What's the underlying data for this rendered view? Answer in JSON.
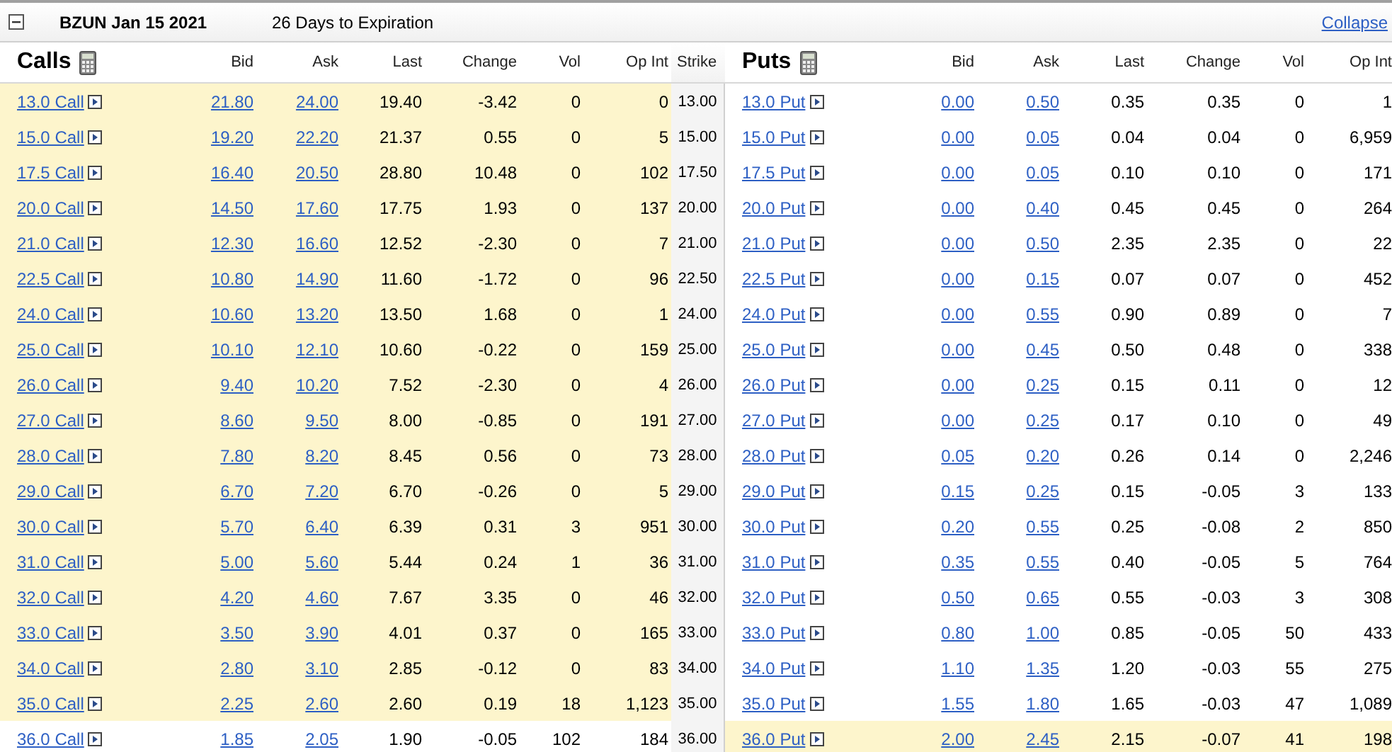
{
  "header": {
    "symbol_date": "BZUN Jan 15 2021",
    "expiration": "26 Days to Expiration",
    "collapse_link": "Collapse",
    "expanded": true
  },
  "columns": {
    "calls_title": "Calls",
    "puts_title": "Puts",
    "calls": [
      "Bid",
      "Ask",
      "Last",
      "Change",
      "Vol",
      "Op Int"
    ],
    "strike": "Strike",
    "puts": [
      "Bid",
      "Ask",
      "Last",
      "Change",
      "Vol",
      "Op Int"
    ]
  },
  "rows": [
    {
      "strike": "13.00",
      "call": {
        "contract": "13.0 Call",
        "bid": "21.80",
        "ask": "24.00",
        "last": "19.40",
        "change": "-3.42",
        "vol": "0",
        "op_int": "0",
        "in_the_money": true
      },
      "put": {
        "contract": "13.0 Put",
        "bid": "0.00",
        "ask": "0.50",
        "last": "0.35",
        "change": "0.35",
        "vol": "0",
        "op_int": "1",
        "in_the_money": false
      }
    },
    {
      "strike": "15.00",
      "call": {
        "contract": "15.0 Call",
        "bid": "19.20",
        "ask": "22.20",
        "last": "21.37",
        "change": "0.55",
        "vol": "0",
        "op_int": "5",
        "in_the_money": true
      },
      "put": {
        "contract": "15.0 Put",
        "bid": "0.00",
        "ask": "0.05",
        "last": "0.04",
        "change": "0.04",
        "vol": "0",
        "op_int": "6,959",
        "in_the_money": false
      }
    },
    {
      "strike": "17.50",
      "call": {
        "contract": "17.5 Call",
        "bid": "16.40",
        "ask": "20.50",
        "last": "28.80",
        "change": "10.48",
        "vol": "0",
        "op_int": "102",
        "in_the_money": true
      },
      "put": {
        "contract": "17.5 Put",
        "bid": "0.00",
        "ask": "0.05",
        "last": "0.10",
        "change": "0.10",
        "vol": "0",
        "op_int": "171",
        "in_the_money": false
      }
    },
    {
      "strike": "20.00",
      "call": {
        "contract": "20.0 Call",
        "bid": "14.50",
        "ask": "17.60",
        "last": "17.75",
        "change": "1.93",
        "vol": "0",
        "op_int": "137",
        "in_the_money": true
      },
      "put": {
        "contract": "20.0 Put",
        "bid": "0.00",
        "ask": "0.40",
        "last": "0.45",
        "change": "0.45",
        "vol": "0",
        "op_int": "264",
        "in_the_money": false
      }
    },
    {
      "strike": "21.00",
      "call": {
        "contract": "21.0 Call",
        "bid": "12.30",
        "ask": "16.60",
        "last": "12.52",
        "change": "-2.30",
        "vol": "0",
        "op_int": "7",
        "in_the_money": true
      },
      "put": {
        "contract": "21.0 Put",
        "bid": "0.00",
        "ask": "0.50",
        "last": "2.35",
        "change": "2.35",
        "vol": "0",
        "op_int": "22",
        "in_the_money": false
      }
    },
    {
      "strike": "22.50",
      "call": {
        "contract": "22.5 Call",
        "bid": "10.80",
        "ask": "14.90",
        "last": "11.60",
        "change": "-1.72",
        "vol": "0",
        "op_int": "96",
        "in_the_money": true
      },
      "put": {
        "contract": "22.5 Put",
        "bid": "0.00",
        "ask": "0.15",
        "last": "0.07",
        "change": "0.07",
        "vol": "0",
        "op_int": "452",
        "in_the_money": false
      }
    },
    {
      "strike": "24.00",
      "call": {
        "contract": "24.0 Call",
        "bid": "10.60",
        "ask": "13.20",
        "last": "13.50",
        "change": "1.68",
        "vol": "0",
        "op_int": "1",
        "in_the_money": true
      },
      "put": {
        "contract": "24.0 Put",
        "bid": "0.00",
        "ask": "0.55",
        "last": "0.90",
        "change": "0.89",
        "vol": "0",
        "op_int": "7",
        "in_the_money": false
      }
    },
    {
      "strike": "25.00",
      "call": {
        "contract": "25.0 Call",
        "bid": "10.10",
        "ask": "12.10",
        "last": "10.60",
        "change": "-0.22",
        "vol": "0",
        "op_int": "159",
        "in_the_money": true
      },
      "put": {
        "contract": "25.0 Put",
        "bid": "0.00",
        "ask": "0.45",
        "last": "0.50",
        "change": "0.48",
        "vol": "0",
        "op_int": "338",
        "in_the_money": false
      }
    },
    {
      "strike": "26.00",
      "call": {
        "contract": "26.0 Call",
        "bid": "9.40",
        "ask": "10.20",
        "last": "7.52",
        "change": "-2.30",
        "vol": "0",
        "op_int": "4",
        "in_the_money": true
      },
      "put": {
        "contract": "26.0 Put",
        "bid": "0.00",
        "ask": "0.25",
        "last": "0.15",
        "change": "0.11",
        "vol": "0",
        "op_int": "12",
        "in_the_money": false
      }
    },
    {
      "strike": "27.00",
      "call": {
        "contract": "27.0 Call",
        "bid": "8.60",
        "ask": "9.50",
        "last": "8.00",
        "change": "-0.85",
        "vol": "0",
        "op_int": "191",
        "in_the_money": true
      },
      "put": {
        "contract": "27.0 Put",
        "bid": "0.00",
        "ask": "0.25",
        "last": "0.17",
        "change": "0.10",
        "vol": "0",
        "op_int": "49",
        "in_the_money": false
      }
    },
    {
      "strike": "28.00",
      "call": {
        "contract": "28.0 Call",
        "bid": "7.80",
        "ask": "8.20",
        "last": "8.45",
        "change": "0.56",
        "vol": "0",
        "op_int": "73",
        "in_the_money": true
      },
      "put": {
        "contract": "28.0 Put",
        "bid": "0.05",
        "ask": "0.20",
        "last": "0.26",
        "change": "0.14",
        "vol": "0",
        "op_int": "2,246",
        "in_the_money": false
      }
    },
    {
      "strike": "29.00",
      "call": {
        "contract": "29.0 Call",
        "bid": "6.70",
        "ask": "7.20",
        "last": "6.70",
        "change": "-0.26",
        "vol": "0",
        "op_int": "5",
        "in_the_money": true
      },
      "put": {
        "contract": "29.0 Put",
        "bid": "0.15",
        "ask": "0.25",
        "last": "0.15",
        "change": "-0.05",
        "vol": "3",
        "op_int": "133",
        "in_the_money": false
      }
    },
    {
      "strike": "30.00",
      "call": {
        "contract": "30.0 Call",
        "bid": "5.70",
        "ask": "6.40",
        "last": "6.39",
        "change": "0.31",
        "vol": "3",
        "op_int": "951",
        "in_the_money": true
      },
      "put": {
        "contract": "30.0 Put",
        "bid": "0.20",
        "ask": "0.55",
        "last": "0.25",
        "change": "-0.08",
        "vol": "2",
        "op_int": "850",
        "in_the_money": false
      }
    },
    {
      "strike": "31.00",
      "call": {
        "contract": "31.0 Call",
        "bid": "5.00",
        "ask": "5.60",
        "last": "5.44",
        "change": "0.24",
        "vol": "1",
        "op_int": "36",
        "in_the_money": true
      },
      "put": {
        "contract": "31.0 Put",
        "bid": "0.35",
        "ask": "0.55",
        "last": "0.40",
        "change": "-0.05",
        "vol": "5",
        "op_int": "764",
        "in_the_money": false
      }
    },
    {
      "strike": "32.00",
      "call": {
        "contract": "32.0 Call",
        "bid": "4.20",
        "ask": "4.60",
        "last": "7.67",
        "change": "3.35",
        "vol": "0",
        "op_int": "46",
        "in_the_money": true
      },
      "put": {
        "contract": "32.0 Put",
        "bid": "0.50",
        "ask": "0.65",
        "last": "0.55",
        "change": "-0.03",
        "vol": "3",
        "op_int": "308",
        "in_the_money": false
      }
    },
    {
      "strike": "33.00",
      "call": {
        "contract": "33.0 Call",
        "bid": "3.50",
        "ask": "3.90",
        "last": "4.01",
        "change": "0.37",
        "vol": "0",
        "op_int": "165",
        "in_the_money": true
      },
      "put": {
        "contract": "33.0 Put",
        "bid": "0.80",
        "ask": "1.00",
        "last": "0.85",
        "change": "-0.05",
        "vol": "50",
        "op_int": "433",
        "in_the_money": false
      }
    },
    {
      "strike": "34.00",
      "call": {
        "contract": "34.0 Call",
        "bid": "2.80",
        "ask": "3.10",
        "last": "2.85",
        "change": "-0.12",
        "vol": "0",
        "op_int": "83",
        "in_the_money": true
      },
      "put": {
        "contract": "34.0 Put",
        "bid": "1.10",
        "ask": "1.35",
        "last": "1.20",
        "change": "-0.03",
        "vol": "55",
        "op_int": "275",
        "in_the_money": false
      }
    },
    {
      "strike": "35.00",
      "call": {
        "contract": "35.0 Call",
        "bid": "2.25",
        "ask": "2.60",
        "last": "2.60",
        "change": "0.19",
        "vol": "18",
        "op_int": "1,123",
        "in_the_money": true
      },
      "put": {
        "contract": "35.0 Put",
        "bid": "1.55",
        "ask": "1.80",
        "last": "1.65",
        "change": "-0.03",
        "vol": "47",
        "op_int": "1,089",
        "in_the_money": false
      }
    },
    {
      "strike": "36.00",
      "call": {
        "contract": "36.0 Call",
        "bid": "1.85",
        "ask": "2.05",
        "last": "1.90",
        "change": "-0.05",
        "vol": "102",
        "op_int": "184",
        "in_the_money": false
      },
      "put": {
        "contract": "36.0 Put",
        "bid": "2.00",
        "ask": "2.45",
        "last": "2.15",
        "change": "-0.07",
        "vol": "41",
        "op_int": "198",
        "in_the_money": true
      }
    }
  ]
}
